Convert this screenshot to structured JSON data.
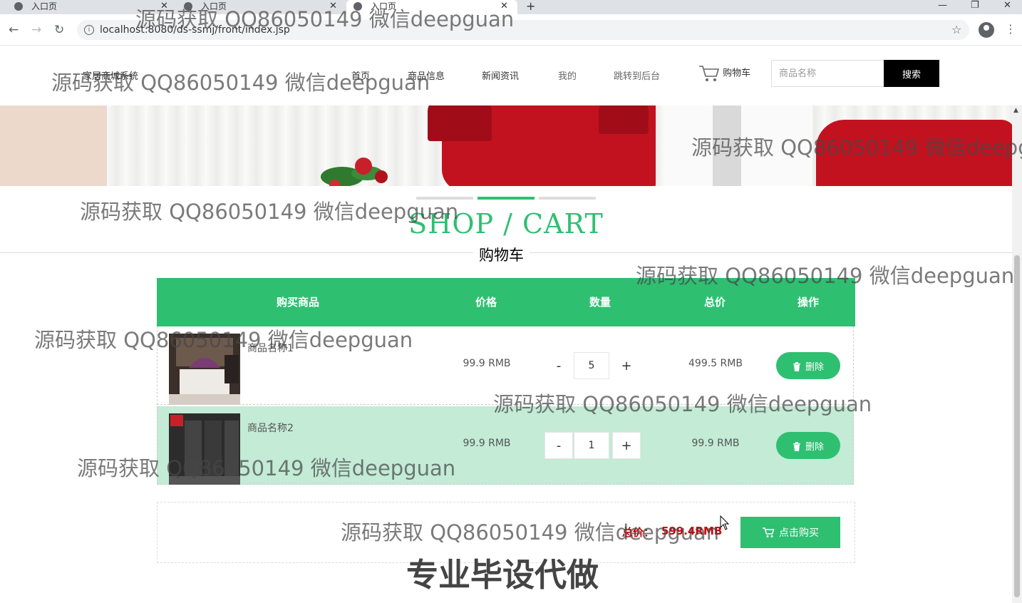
{
  "browser": {
    "tabs": [
      {
        "title": "入口页",
        "close": "✕"
      },
      {
        "title": "入口页",
        "close": "✕"
      },
      {
        "title": "入口页",
        "close": "✕"
      }
    ],
    "new_tab": "+",
    "url": "localhost:8080/ds-ssmj/front/index.jsp",
    "back": "←",
    "forward": "→",
    "reload": "↻",
    "star": "☆",
    "menu": "⋮",
    "win_min": "—",
    "win_restore": "❐",
    "win_close": "✕"
  },
  "header": {
    "brand": "家居商城系统",
    "nav": [
      "首页",
      "商品信息",
      "新闻资讯",
      "我的",
      "跳转到后台"
    ],
    "cart": "购物车",
    "search_placeholder": "商品名称",
    "search_button": "搜索"
  },
  "section": {
    "title": "SHOP / CART",
    "subtitle": "购物车"
  },
  "table": {
    "columns": [
      "购买商品",
      "价格",
      "数量",
      "总价",
      "操作"
    ],
    "rows": [
      {
        "name": "商品名称1",
        "price": "99.9 RMB",
        "qty": "5",
        "total": "499.5 RMB",
        "delete": "删除",
        "minus": "-",
        "plus": "+"
      },
      {
        "name": "商品名称2",
        "price": "99.9 RMB",
        "qty": "1",
        "total": "99.9 RMB",
        "delete": "删除",
        "minus": "-",
        "plus": "+"
      }
    ]
  },
  "summary": {
    "label": "总价：",
    "value": "599.4RMB",
    "buy_button": "点击购买"
  },
  "watermark": "源码获取 QQ86050149 微信deepguan",
  "promo": "专业毕设代做",
  "colors": {
    "accent": "#2fbf71",
    "row_highlight": "#c3ebd6",
    "price_red": "#cc0000"
  }
}
